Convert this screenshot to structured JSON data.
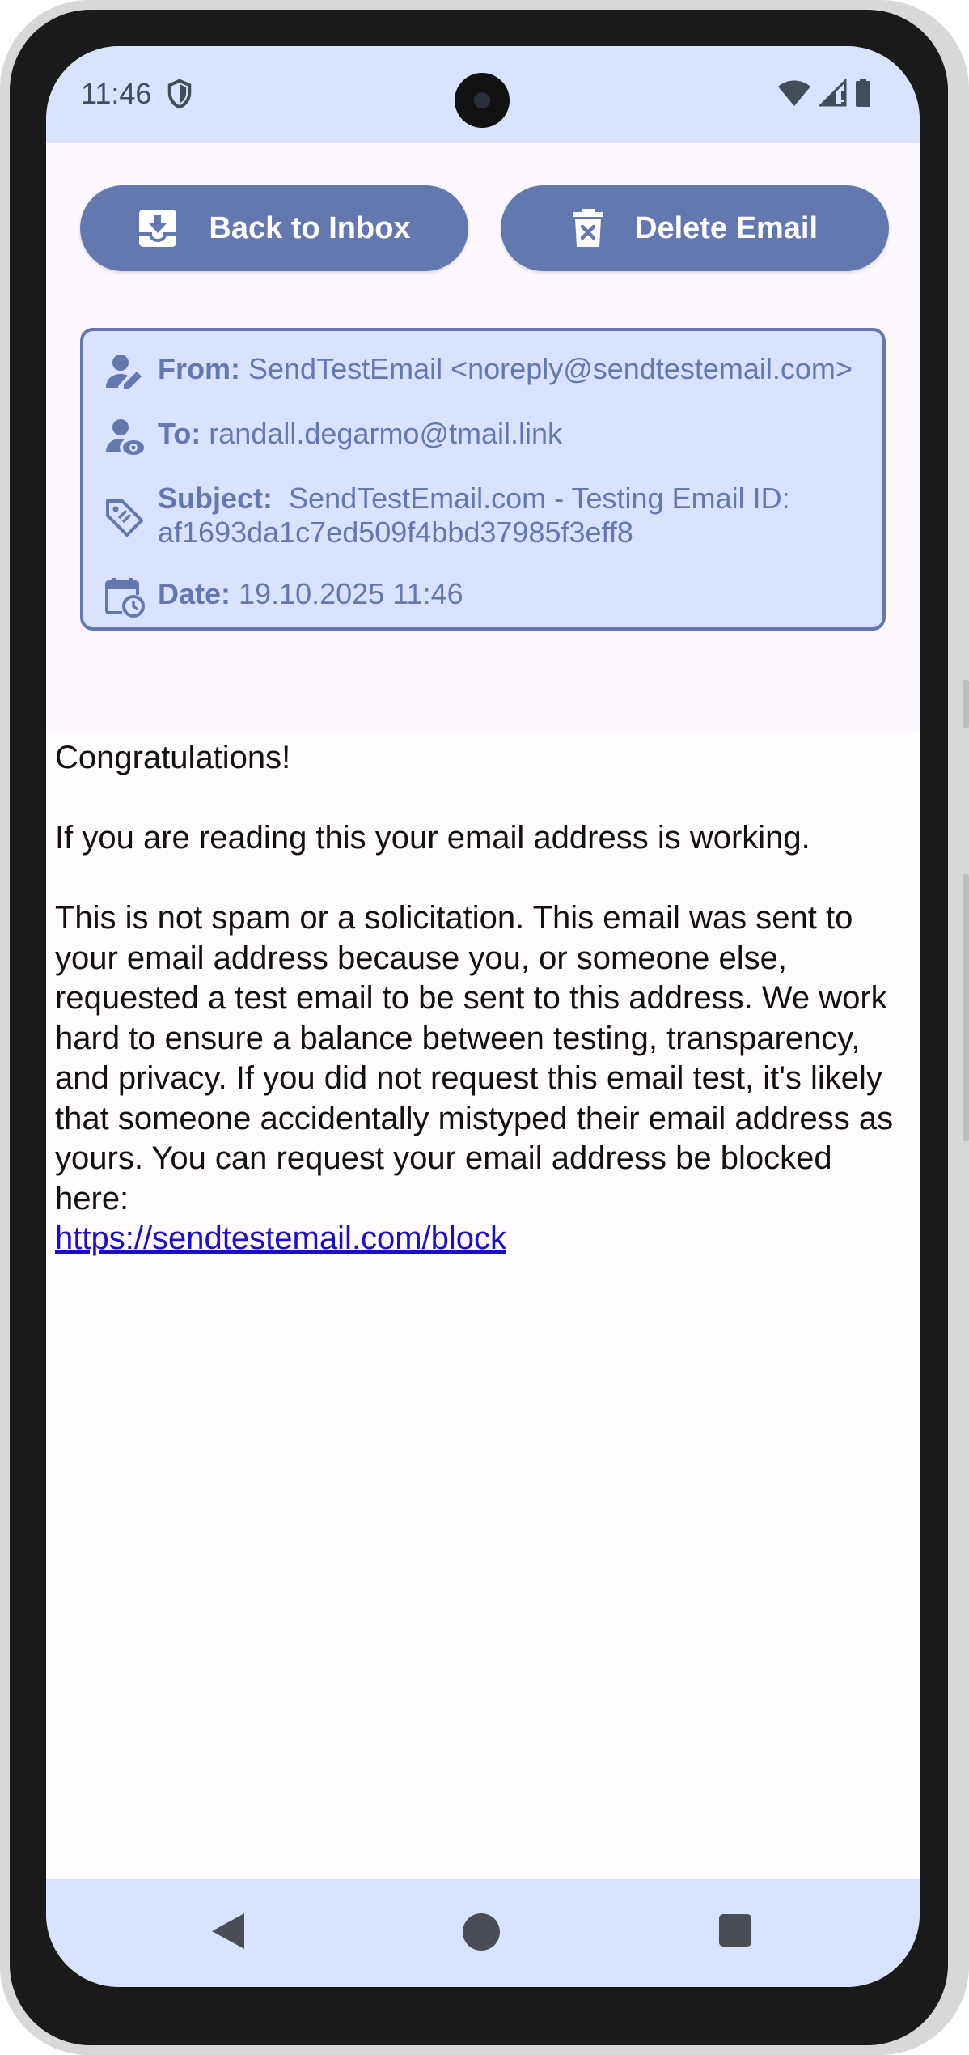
{
  "status_bar": {
    "time": "11:46"
  },
  "toolbar": {
    "back_label": "Back to Inbox",
    "delete_label": "Delete Email"
  },
  "email": {
    "from_label": "From:",
    "from_value": "SendTestEmail <noreply@sendtestemail.com>",
    "to_label": "To:",
    "to_value": "randall.degarmo@tmail.link",
    "subject_label": "Subject:",
    "subject_value": "SendTestEmail.com - Testing Email ID: af1693da1c7ed509f4bbd37985f3eff8",
    "date_label": "Date:",
    "date_value": "19.10.2025 11:46"
  },
  "body": {
    "greeting": "Congratulations!",
    "line1": "If you are reading this your email address is working.",
    "paragraph": "This is not spam or a solicitation. This email was sent to your email address because you, or someone else, requested a test email to be sent to this address. We work hard to ensure a balance between testing, transparency, and privacy. If you did not request this email test, it's likely that someone accidentally mistyped their email address as yours. You can request your email address be blocked here:",
    "link": "https://sendtestemail.com/block"
  },
  "colors": {
    "accent": "#6478b0",
    "card_bg": "#d9e2ff",
    "link": "#1a0dcc"
  },
  "icons": {
    "shield": "shield-icon",
    "wifi": "wifi-icon",
    "signal": "signal-icon",
    "battery": "battery-icon",
    "back_button": "inbox-download-icon",
    "delete_button": "trash-icon",
    "from": "person-edit-icon",
    "to": "person-eye-icon",
    "subject": "tag-icon",
    "date": "calendar-clock-icon"
  }
}
